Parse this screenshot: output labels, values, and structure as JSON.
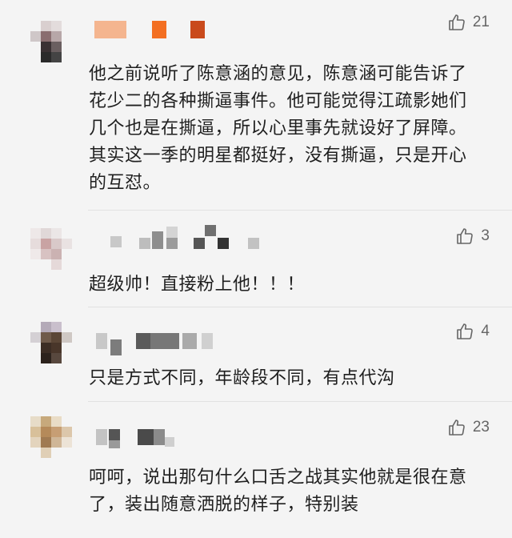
{
  "comments": [
    {
      "likes": "21",
      "text": "他之前说听了陈意涵的意见，陈意涵可能告诉了花少二的各种撕逼事件。他可能觉得江疏影她们几个也是在撕逼，所以心里事先就设好了屏障。其实这一季的明星都挺好，没有撕逼，只是开心的互怼。"
    },
    {
      "likes": "3",
      "text": "超级帅！直接粉上他！！！"
    },
    {
      "likes": "4",
      "text": "只是方式不同，年龄段不同，有点代沟"
    },
    {
      "likes": "23",
      "text": "呵呵，说出那句什么口舌之战其实他就是很在意了，装出随意洒脱的样子，特别装"
    }
  ],
  "icons": {
    "like": "thumbs-up-icon"
  },
  "colors": {
    "background": "#f4f4f4",
    "text": "#1f1f1f",
    "like": "#666666"
  }
}
